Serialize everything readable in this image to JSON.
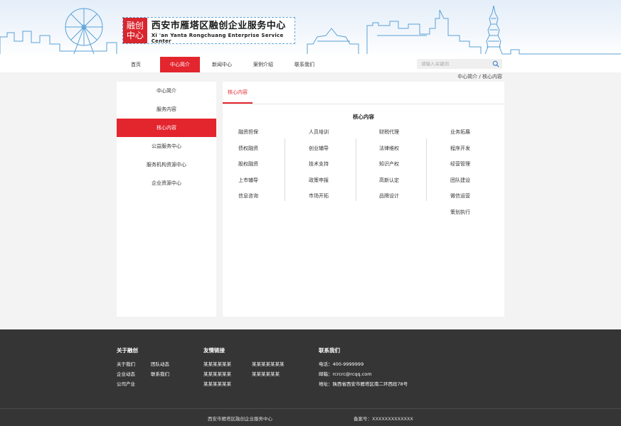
{
  "header": {
    "logo_mark": "融创中心",
    "title_cn": "西安市雁塔区融创企业服务中心",
    "title_en": "Xi 'an Yanta Rongchuang Enterprise Service Center"
  },
  "nav": {
    "items": [
      "首页",
      "中心简介",
      "新闻中心",
      "案例介绍",
      "联系我们"
    ],
    "active_index": 1
  },
  "search": {
    "placeholder": "请输入关键词"
  },
  "breadcrumb": "中心简介 / 核心内容",
  "sidebar": {
    "items": [
      "中心简介",
      "服务内容",
      "核心内容",
      "公益服务中心",
      "服务机构资源中心",
      "企业资源中心"
    ],
    "active_index": 2
  },
  "main": {
    "tab": "核心内容",
    "title": "核心内容",
    "columns": [
      [
        "融资担保",
        "债权融资",
        "股权融资",
        "上市辅导",
        "信息咨询"
      ],
      [
        "人员培训",
        "创业辅导",
        "技术支持",
        "政策申报",
        "市场开拓"
      ],
      [
        "财税代理",
        "法律维权",
        "知识产权",
        "高新认定",
        "品牌设计"
      ],
      [
        "业务拓展",
        "程序开发",
        "经营管理",
        "团队建设",
        "微信运营",
        "策划执行"
      ]
    ]
  },
  "footer": {
    "about": {
      "title": "关于融创",
      "links": [
        "关于我们",
        "团队动态",
        "企业动态",
        "联系我们",
        "公司产业"
      ]
    },
    "friends": {
      "title": "友情链接",
      "links": [
        "某某某某某某",
        "某某某某某某某",
        "某某某某某某",
        "某某某某某某",
        "某某某某某某"
      ]
    },
    "contact": {
      "title": "联系我们",
      "phone": "电话：400-9999999",
      "email": "邮箱：rcrcrc@rcqq.com",
      "address": "地址：陕西省西安市雁塔区南二环西段78号"
    },
    "copyright": "西安市雁塔区融创企业服务中心",
    "icp": "备案号：XXXXXXXXXXXXX"
  },
  "colors": {
    "accent": "#e3252e",
    "footer_bg": "#353535",
    "skyline": "#5aa2d6"
  }
}
